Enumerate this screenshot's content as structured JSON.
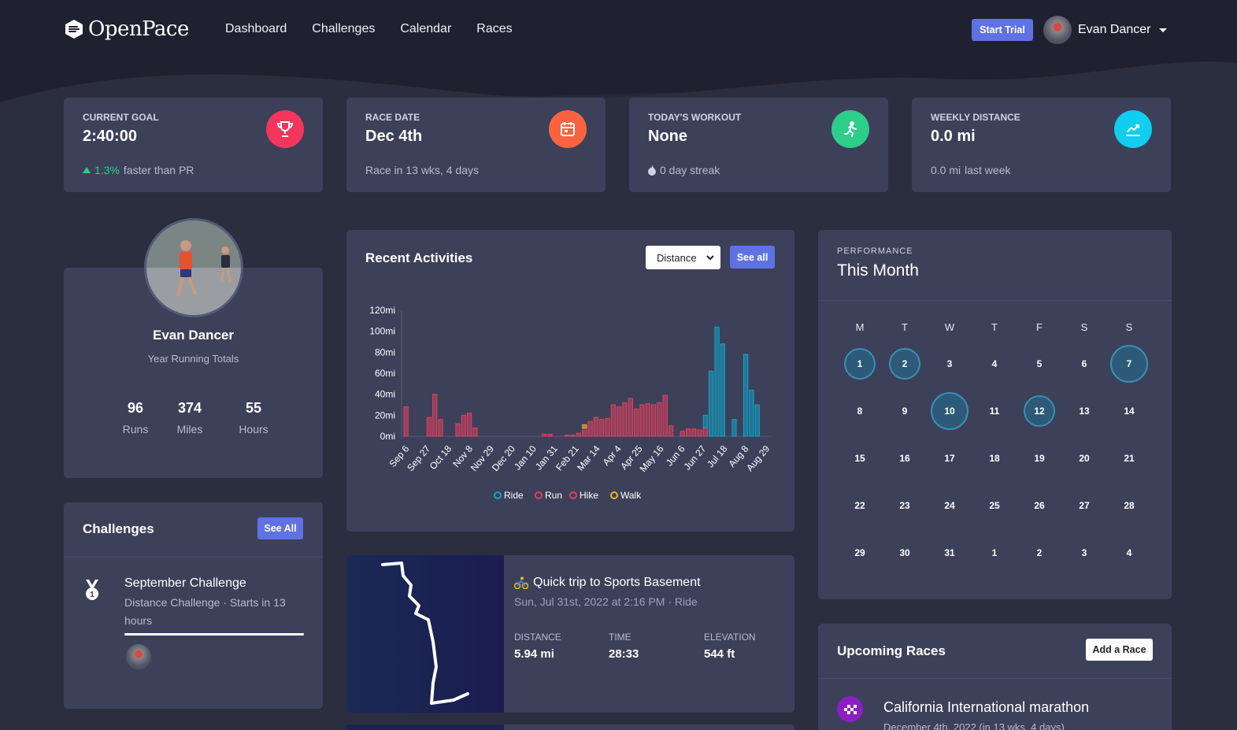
{
  "nav": {
    "brand": "OpenPace",
    "links": [
      "Dashboard",
      "Challenges",
      "Calendar",
      "Races"
    ],
    "trial_button": "Start Trial",
    "user_name": "Evan Dancer"
  },
  "stats": [
    {
      "label": "Current Goal",
      "value": "2:40:00",
      "sub_accent": "1.3%",
      "sub": "faster than PR",
      "color": "#f5365c",
      "icon": "trophy-icon"
    },
    {
      "label": "Race Date",
      "value": "Dec 4th",
      "sub": "Race in 13 wks, 4 days",
      "color": "#fb6340",
      "icon": "calendar-icon"
    },
    {
      "label": "Today's Workout",
      "value": "None",
      "sub": "0 day streak",
      "color": "#2dce89",
      "icon": "runner-icon"
    },
    {
      "label": "Weekly Distance",
      "value": "0.0 mi",
      "sub_accent": "0.0 mi",
      "sub": "last week",
      "color": "#11cdef",
      "icon": "chart-line-icon"
    }
  ],
  "profile": {
    "name": "Evan Dancer",
    "subtitle": "Year Running Totals",
    "totals": [
      {
        "value": "96",
        "label": "Runs"
      },
      {
        "value": "374",
        "label": "Miles"
      },
      {
        "value": "55",
        "label": "Hours"
      }
    ]
  },
  "challenges": {
    "title": "Challenges",
    "see_all": "See All",
    "item": {
      "name": "September Challenge",
      "desc_line1": "Distance Challenge · Starts in 13",
      "desc_line2": "hours"
    }
  },
  "activities": {
    "title": "Recent Activities",
    "select": "Distance",
    "see_all": "See all"
  },
  "chart_data": {
    "type": "bar",
    "ylabel": "",
    "ylim": [
      0,
      120
    ],
    "yticks": [
      "120mi",
      "100mi",
      "80mi",
      "60mi",
      "40mi",
      "20mi",
      "0mi"
    ],
    "xticks": [
      "Sep 6",
      "Sep 27",
      "Oct 18",
      "Nov 8",
      "Nov 29",
      "Dec 20",
      "Jan 10",
      "Jan 31",
      "Feb 21",
      "Mar 14",
      "Apr 4",
      "Apr 25",
      "May 16",
      "Jun 6",
      "Jun 27",
      "Jul 18",
      "Aug 8",
      "Aug 29"
    ],
    "series": [
      {
        "name": "Ride",
        "color": "#11a4c8",
        "values": [
          0,
          0,
          0,
          0,
          0,
          0,
          0,
          0,
          0,
          0,
          0,
          0,
          0,
          0,
          0,
          0,
          0,
          0,
          0,
          0,
          0,
          0,
          0,
          0,
          0,
          0,
          0,
          0,
          0,
          0,
          0,
          0,
          0,
          0,
          0,
          0,
          0,
          0,
          0,
          0,
          0,
          0,
          0,
          0,
          0,
          0,
          0,
          0,
          0,
          0,
          0,
          0,
          12,
          62,
          104,
          88,
          0,
          16,
          0,
          78,
          44,
          30,
          0,
          0
        ]
      },
      {
        "name": "Run",
        "color": "#e0405f",
        "values": [
          28,
          0,
          0,
          0,
          18,
          40,
          16,
          0,
          0,
          12,
          20,
          22,
          8,
          0,
          0,
          0,
          0,
          0,
          0,
          0,
          0,
          0,
          0,
          0,
          2,
          2,
          0,
          0,
          1,
          1,
          3,
          8,
          14,
          18,
          16,
          17,
          30,
          28,
          32,
          36,
          26,
          30,
          31,
          30,
          32,
          39,
          10,
          0,
          5,
          7,
          7,
          6,
          8,
          0,
          0,
          0,
          0,
          0,
          0,
          0,
          0,
          0,
          0,
          0
        ]
      },
      {
        "name": "Hike",
        "color": "#e0405f",
        "values": [
          0,
          0,
          0,
          0,
          0,
          0,
          0,
          0,
          0,
          0,
          0,
          0,
          0,
          0,
          0,
          0,
          0,
          0,
          0,
          0,
          0,
          0,
          0,
          0,
          0,
          0,
          0,
          0,
          0,
          0,
          0,
          0,
          0,
          0,
          0,
          0,
          0,
          0,
          0,
          0,
          0,
          0,
          0,
          0,
          0,
          0,
          0,
          0,
          0,
          0,
          0,
          0,
          0,
          0,
          0,
          0,
          0,
          0,
          0,
          0,
          0,
          0,
          0,
          0
        ]
      },
      {
        "name": "Walk",
        "color": "#e8b62a",
        "values": [
          0,
          0,
          0,
          0,
          0,
          0,
          0,
          0,
          0,
          0,
          0,
          0,
          0,
          0,
          0,
          0,
          0,
          0,
          0,
          0,
          0,
          0,
          0,
          0,
          0,
          0,
          0,
          0,
          0,
          0,
          0,
          3,
          0,
          0,
          0,
          0,
          0,
          0,
          0,
          0,
          0,
          0,
          0,
          0,
          0,
          0,
          0,
          0,
          0,
          0,
          0,
          0,
          0,
          0,
          0,
          0,
          0,
          0,
          0,
          0,
          0,
          0,
          0,
          0
        ]
      }
    ],
    "stacked_ride_on_run_index": [
      52,
      53
    ]
  },
  "activity": {
    "title": "Quick trip to Sports Basement",
    "meta": "Sun, Jul 31st, 2022 at 2:16 PM · Ride",
    "metrics": [
      {
        "label": "Distance",
        "value": "5.94 mi"
      },
      {
        "label": "Time",
        "value": "28:33"
      },
      {
        "label": "Elevation",
        "value": "544 ft"
      }
    ]
  },
  "performance": {
    "kicker": "Performance",
    "title": "This Month",
    "weekdays": [
      "M",
      "T",
      "W",
      "T",
      "F",
      "S",
      "S"
    ],
    "days": [
      [
        "1",
        "2",
        "3",
        "4",
        "5",
        "6",
        "7"
      ],
      [
        "8",
        "9",
        "10",
        "11",
        "12",
        "13",
        "14"
      ],
      [
        "15",
        "16",
        "17",
        "18",
        "19",
        "20",
        "21"
      ],
      [
        "22",
        "23",
        "24",
        "25",
        "26",
        "27",
        "28"
      ],
      [
        "29",
        "30",
        "31",
        "1",
        "2",
        "3",
        "4"
      ]
    ],
    "active_days": {
      "1": 1,
      "2": 1,
      "7": 2,
      "10": 2,
      "12": 1
    }
  },
  "races": {
    "title": "Upcoming Races",
    "add_button": "Add a Race",
    "item_name": "California International marathon",
    "item_meta": "December 4th, 2022 (in 13 wks, 4 days)"
  }
}
